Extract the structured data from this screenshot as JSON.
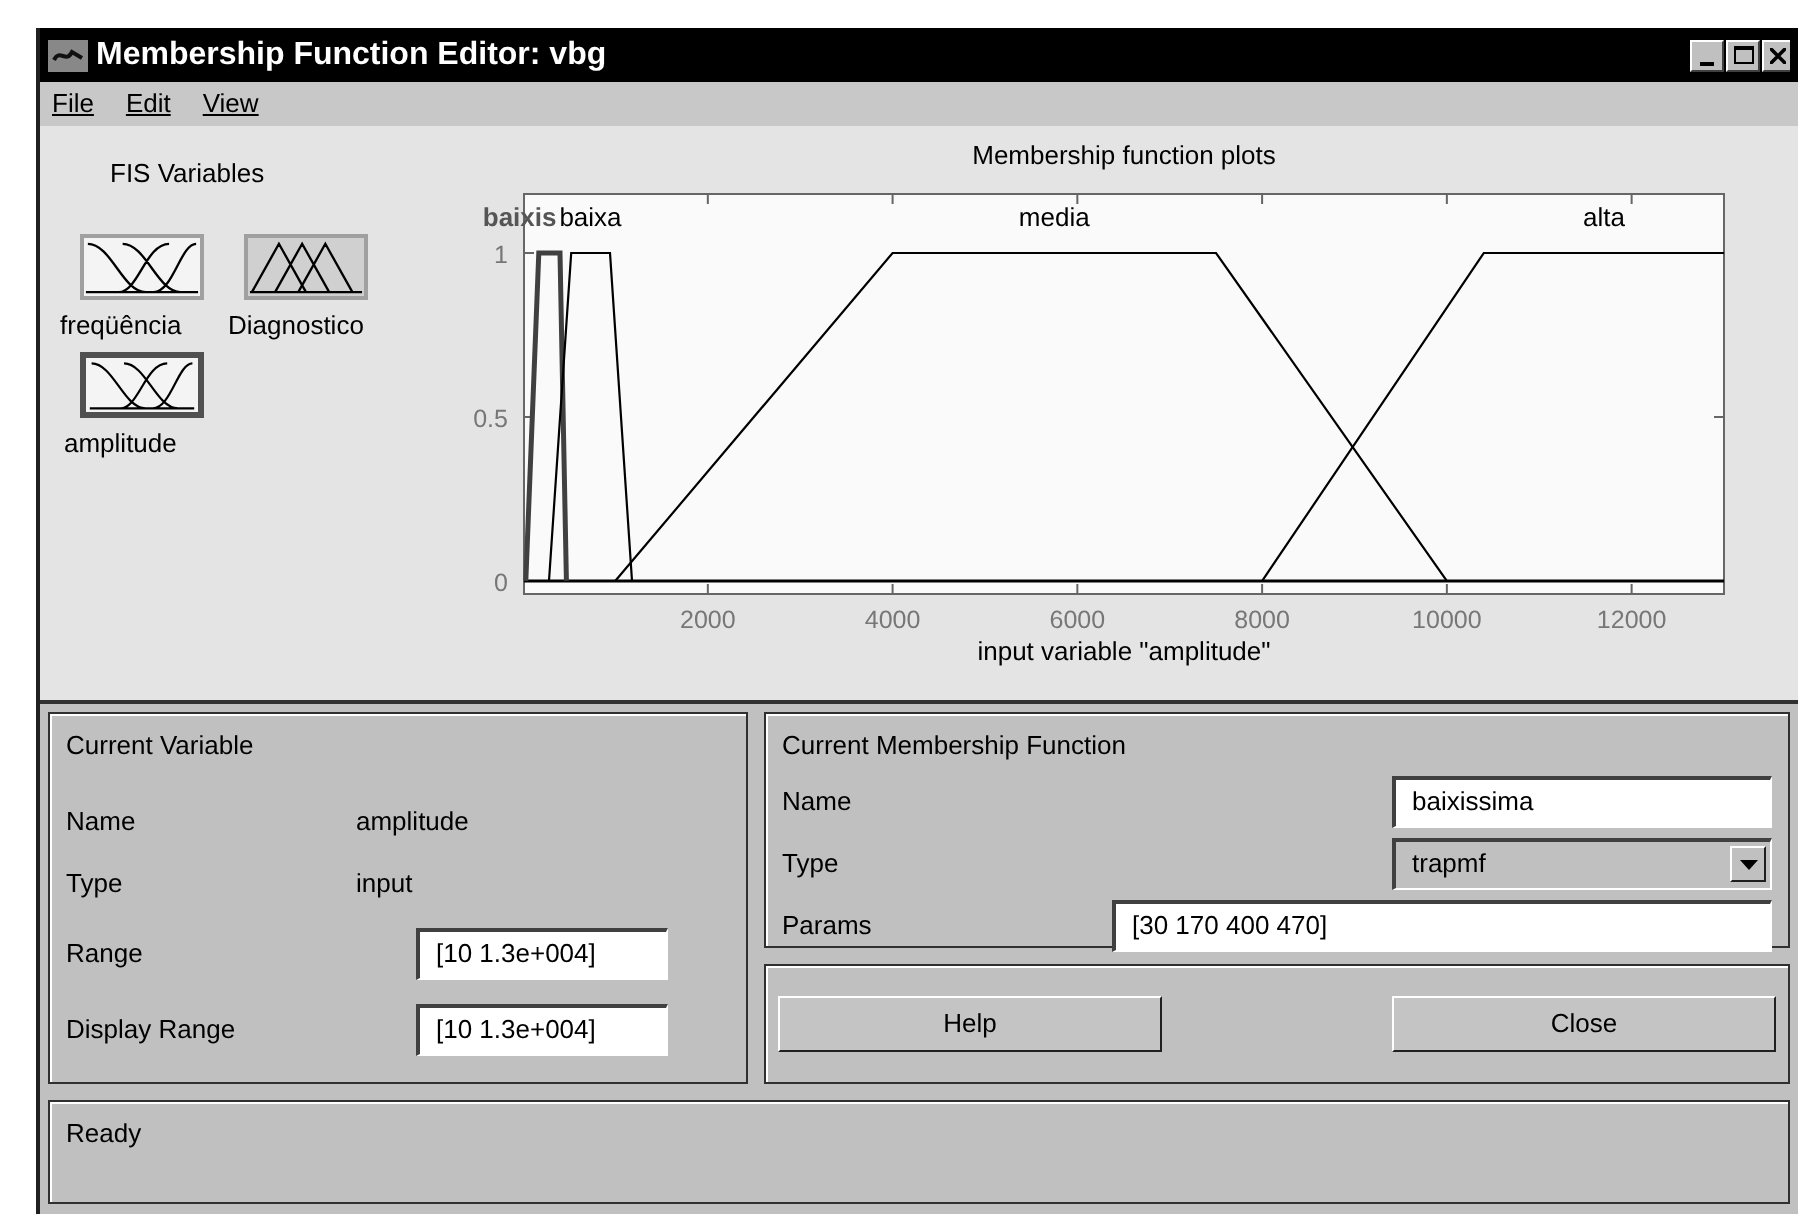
{
  "window": {
    "title": "Membership Function Editor: vbg"
  },
  "menu": [
    "File",
    "Edit",
    "View"
  ],
  "fis_variables": {
    "title": "FIS Variables",
    "items": [
      {
        "label": "freqüência",
        "kind": "input",
        "selected": false
      },
      {
        "label": "Diagnostico",
        "kind": "output",
        "selected": false
      },
      {
        "label": "amplitude",
        "kind": "input",
        "selected": true
      }
    ]
  },
  "plot": {
    "curves": [
      {
        "selected": true
      },
      {
        "selected": false
      },
      {
        "selected": false
      },
      {
        "selected": false
      }
    ],
    "chart_data": {
      "type": "line",
      "title": "Membership function plots",
      "xlabel": "input variable \"amplitude\"",
      "xlim": [
        10,
        13000
      ],
      "ylim": [
        -0.04,
        1.18
      ],
      "xticks": [
        2000,
        4000,
        6000,
        8000,
        10000,
        12000
      ],
      "yticks": [
        0,
        0.5,
        1
      ],
      "series": [
        {
          "name": "baixis",
          "color": "#404040",
          "x": [
            30,
            170,
            400,
            470
          ],
          "values": [
            0,
            1,
            1,
            0
          ]
        },
        {
          "name": "baixa",
          "color": "#000000",
          "x": [
            280,
            520,
            940,
            1180
          ],
          "values": [
            0,
            1,
            1,
            0
          ]
        },
        {
          "name": "media",
          "color": "#000000",
          "x": [
            1000,
            4000,
            7500,
            10000
          ],
          "values": [
            0,
            1,
            1,
            0
          ]
        },
        {
          "name": "alta",
          "color": "#000000",
          "x": [
            8000,
            10400,
            13000
          ],
          "values": [
            0,
            1,
            1
          ]
        }
      ]
    }
  },
  "current_variable": {
    "title": "Current Variable",
    "name_label": "Name",
    "name": "amplitude",
    "type_label": "Type",
    "type": "input",
    "range_label": "Range",
    "range": "[10 1.3e+004]",
    "display_range_label": "Display Range",
    "display_range": "[10 1.3e+004]"
  },
  "current_mf": {
    "title": "Current Membership Function",
    "name_label": "Name",
    "name": "baixissima",
    "type_label": "Type",
    "type": "trapmf",
    "params_label": "Params",
    "params": "[30 170 400 470]"
  },
  "buttons": [
    "Help",
    "Close"
  ],
  "status_bar": "Ready"
}
